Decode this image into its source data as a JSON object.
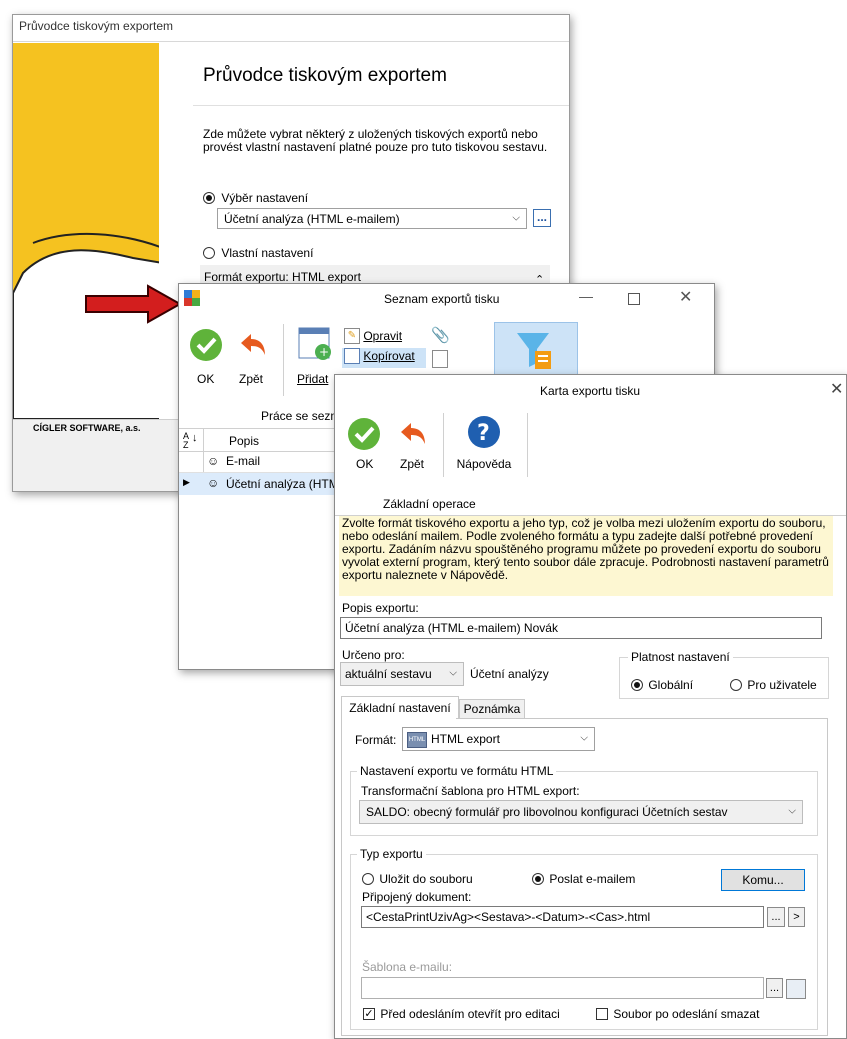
{
  "wizard": {
    "window_title": "Průvodce tiskovým exportem",
    "heading": "Průvodce tiskovým exportem",
    "description": "Zde můžete vybrat některý z uložených tiskových exportů nebo provést vlastní nastavení platné pouze pro tuto tiskovou sestavu.",
    "radio_selection_label": "Výběr nastavení",
    "selected_setting": "Účetní analýza (HTML e-mailem)",
    "radio_custom_label": "Vlastní nastavení",
    "export_format_text": "Formát exportu: HTML export",
    "company": "CÍGLER SOFTWARE, a.s."
  },
  "list_window": {
    "title": "Seznam exportů tisku",
    "toolbar": {
      "ok": "OK",
      "back": "Zpět",
      "add": "Přidat",
      "edit": "Opravit",
      "copy": "Kopírovat"
    },
    "group_label": "Práce se sezn",
    "column_header": "Popis",
    "sort_icon_text": "A↓Z",
    "rows": [
      "E-mail",
      "Účetní analýza (HTM"
    ]
  },
  "card_window": {
    "title": "Karta exportu tisku",
    "toolbar": {
      "ok": "OK",
      "back": "Zpět",
      "help": "Nápověda"
    },
    "group_label": "Základní operace",
    "info_text": "Zvolte formát tiskového exportu a jeho typ, což je volba mezi uložením exportu do souboru, nebo odeslání mailem. Podle zvoleného formátu a typu zadejte další potřebné provedení exportu. Zadáním názvu spouštěného programu můžete po provedení exportu do souboru vyvolat externí program, který tento soubor dále zpracuje. Podrobnosti nastavení parametrů exportu naleznete v Nápovědě.",
    "description_label": "Popis exportu:",
    "description_value": "Účetní analýza (HTML e-mailem) Novák",
    "intended_for_label": "Určeno pro:",
    "intended_for_value": "aktuální sestavu",
    "intended_for_text": "Účetní analýzy",
    "validity_label": "Platnost nastavení",
    "validity_global": "Globální",
    "validity_user": "Pro uživatele",
    "tabs": [
      "Základní nastavení",
      "Poznámka"
    ],
    "format_label": "Formát:",
    "format_value": "HTML export",
    "html_group_label": "Nastavení exportu ve formátu HTML",
    "template_label": "Transformační šablona pro HTML export:",
    "template_value": "SALDO: obecný formulář pro libovolnou konfiguraci Účetních sestav",
    "type_group_label": "Typ exportu",
    "save_to_file": "Uložit do souboru",
    "send_email": "Poslat e-mailem",
    "to_button": "Komu...",
    "attached_label": "Připojený dokument:",
    "attached_value": "<CestaPrintUzivAg><Sestava>-<Datum>-<Cas>.html",
    "email_template_label": "Šablona e-mailu:",
    "email_template_value": "",
    "open_before_send": "Před odesláním otevřít pro editaci",
    "delete_after_send": "Soubor po odeslání smazat",
    "ellipsis": "...",
    "arrow": ">"
  }
}
